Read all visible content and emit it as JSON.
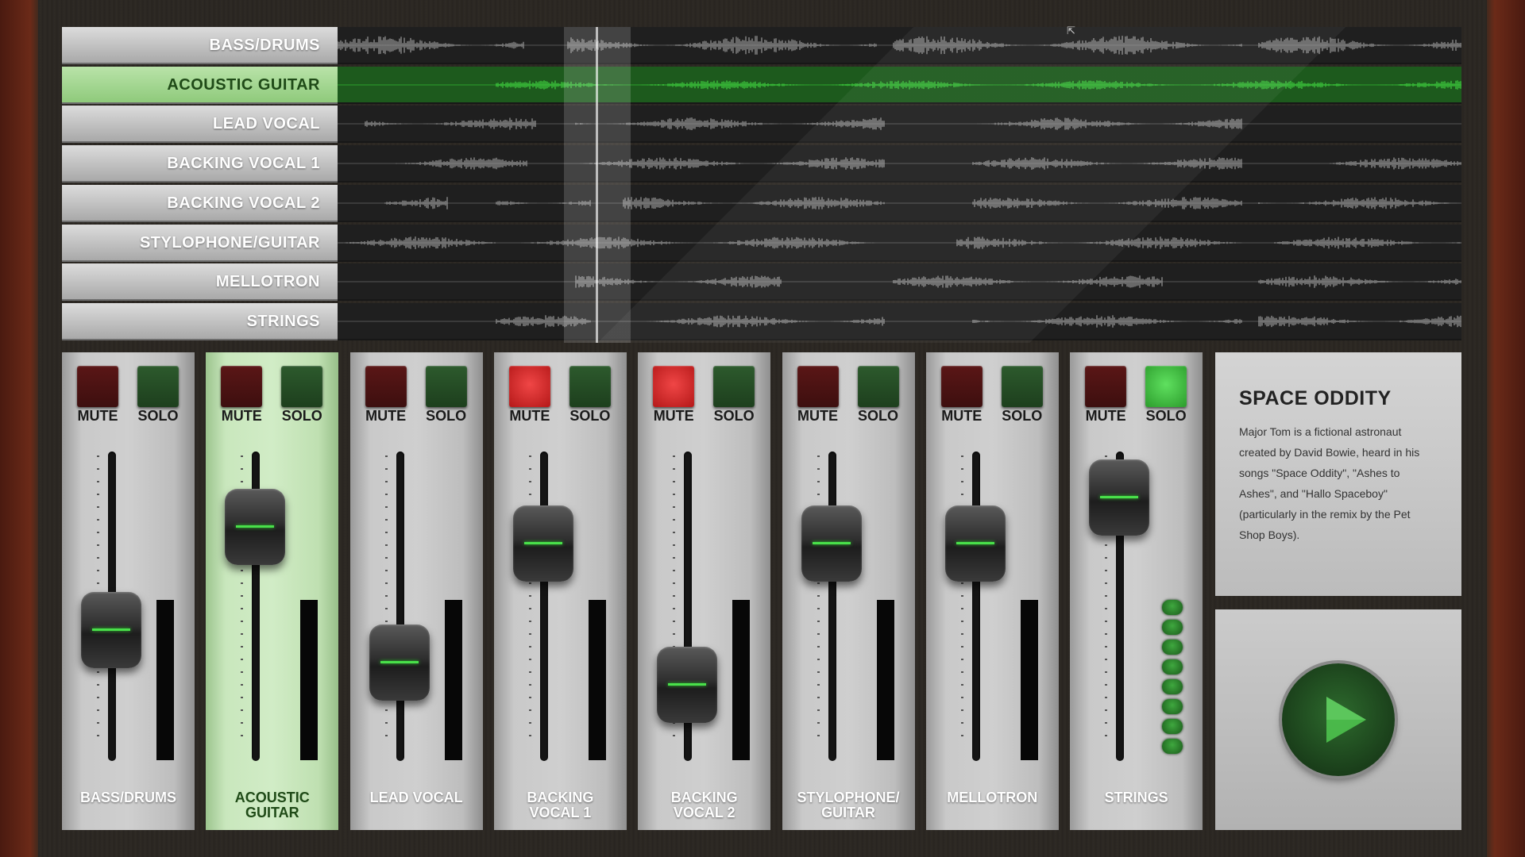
{
  "tracks": [
    {
      "name": "BASS/DRUMS",
      "active": false
    },
    {
      "name": "ACOUSTIC GUITAR",
      "active": true
    },
    {
      "name": "LEAD VOCAL",
      "active": false
    },
    {
      "name": "BACKING VOCAL 1",
      "active": false
    },
    {
      "name": "BACKING VOCAL 2",
      "active": false
    },
    {
      "name": "STYLOPHONE/GUITAR",
      "active": false
    },
    {
      "name": "MELLOTRON",
      "active": false
    },
    {
      "name": "STRINGS",
      "active": false
    }
  ],
  "mixer": {
    "mute_label": "MUTE",
    "solo_label": "SOLO",
    "channels": [
      {
        "name_line1": "BASS/DRUMS",
        "name_line2": "",
        "mute": false,
        "solo": false,
        "fader": 0.4,
        "active": false,
        "meter": "bar"
      },
      {
        "name_line1": "ACOUSTIC",
        "name_line2": "GUITAR",
        "mute": false,
        "solo": false,
        "fader": 0.78,
        "active": true,
        "meter": "bar"
      },
      {
        "name_line1": "LEAD VOCAL",
        "name_line2": "",
        "mute": false,
        "solo": false,
        "fader": 0.28,
        "active": false,
        "meter": "bar"
      },
      {
        "name_line1": "BACKING",
        "name_line2": "VOCAL 1",
        "mute": true,
        "solo": false,
        "fader": 0.72,
        "active": false,
        "meter": "bar"
      },
      {
        "name_line1": "BACKING",
        "name_line2": "VOCAL 2",
        "mute": true,
        "solo": false,
        "fader": 0.2,
        "active": false,
        "meter": "bar"
      },
      {
        "name_line1": "STYLOPHONE/",
        "name_line2": "GUITAR",
        "mute": false,
        "solo": false,
        "fader": 0.72,
        "active": false,
        "meter": "bar"
      },
      {
        "name_line1": "MELLOTRON",
        "name_line2": "",
        "mute": false,
        "solo": false,
        "fader": 0.72,
        "active": false,
        "meter": "bar"
      },
      {
        "name_line1": "STRINGS",
        "name_line2": "",
        "mute": false,
        "solo": true,
        "fader": 0.89,
        "active": false,
        "meter": "leds"
      }
    ]
  },
  "info": {
    "title": "SPACE ODDITY",
    "description": "Major Tom is a fictional astronaut created by David Bowie, heard in his songs \"Space Oddity\", \"Ashes to Ashes\", and \"Hallo Spaceboy\" (particularly in the remix by the Pet Shop Boys)."
  },
  "transport": {
    "icon": "play-icon"
  },
  "playhead_fraction": 0.23,
  "colors": {
    "accent_green": "#49e04a",
    "mute_on": "#e23434",
    "solo_on": "#4fd14f"
  }
}
